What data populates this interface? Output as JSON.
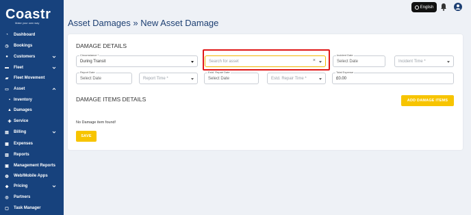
{
  "brand": {
    "name": "Coastr",
    "tagline": "Make your own way"
  },
  "sidebar": {
    "items": [
      {
        "label": "Dashboard",
        "icon": "dashboard-icon",
        "chevron": false,
        "sub": false
      },
      {
        "label": "Bookings",
        "icon": "bookings-icon",
        "chevron": false,
        "sub": false
      },
      {
        "label": "Customers",
        "icon": "customers-icon",
        "chevron": true,
        "sub": false
      },
      {
        "label": "Fleet",
        "icon": "car-icon",
        "chevron": true,
        "sub": false
      },
      {
        "label": "Fleet Movement",
        "icon": "truck-icon",
        "chevron": false,
        "sub": false
      },
      {
        "label": "Asset",
        "icon": "asset-icon",
        "chevron": true,
        "sub": false
      },
      {
        "label": "Inventory",
        "icon": "inventory-icon",
        "chevron": false,
        "sub": true
      },
      {
        "label": "Damages",
        "icon": "warning-icon",
        "chevron": false,
        "sub": true
      },
      {
        "label": "Service",
        "icon": "wrench-icon",
        "chevron": false,
        "sub": true
      },
      {
        "label": "Billing",
        "icon": "billing-icon",
        "chevron": true,
        "sub": false
      },
      {
        "label": "Expenses",
        "icon": "expenses-icon",
        "chevron": false,
        "sub": false
      },
      {
        "label": "Reports",
        "icon": "reports-icon",
        "chevron": false,
        "sub": false
      },
      {
        "label": "Management Reports",
        "icon": "management-reports-icon",
        "chevron": false,
        "sub": false
      },
      {
        "label": "Web/Mobile Apps",
        "icon": "globe-icon",
        "chevron": false,
        "sub": false
      },
      {
        "label": "Pricing",
        "icon": "pricing-icon",
        "chevron": true,
        "sub": false
      },
      {
        "label": "Partners",
        "icon": "partners-icon",
        "chevron": false,
        "sub": false
      },
      {
        "label": "Task Manager",
        "icon": "task-icon",
        "chevron": false,
        "sub": false
      }
    ]
  },
  "topbar": {
    "language": "English"
  },
  "page": {
    "title": "Asset Damages  »  New Asset Damage"
  },
  "damage_details": {
    "heading": "DAMAGE DETAILS",
    "circumstance": {
      "label": "Circumstance *",
      "value": "During Transit"
    },
    "asset": {
      "placeholder": "Search for asset"
    },
    "incident_date": {
      "label": "Incident Date",
      "placeholder": "Select Date"
    },
    "incident_time": {
      "placeholder": "Incident Time *"
    },
    "report_date": {
      "label": "Report Date",
      "placeholder": "Select Date"
    },
    "report_time": {
      "placeholder": "Report Time *"
    },
    "estd_repair_date": {
      "label": "Estd. Repair Date",
      "placeholder": "Select Date"
    },
    "estd_repair_time": {
      "placeholder": "Estd. Repair Time *"
    },
    "total_expense": {
      "label": "Total Expense",
      "value": "£0.00"
    }
  },
  "damage_items": {
    "heading": "DAMAGE ITEMS DETAILS",
    "add_button": "ADD DAMAGE ITEMS",
    "empty_text": "No Damage item found!"
  },
  "save_button": "SAVE",
  "colors": {
    "sidebar": "#17427d",
    "accent": "#f7c400",
    "highlight": "#e01616",
    "title": "#1d3f72"
  }
}
